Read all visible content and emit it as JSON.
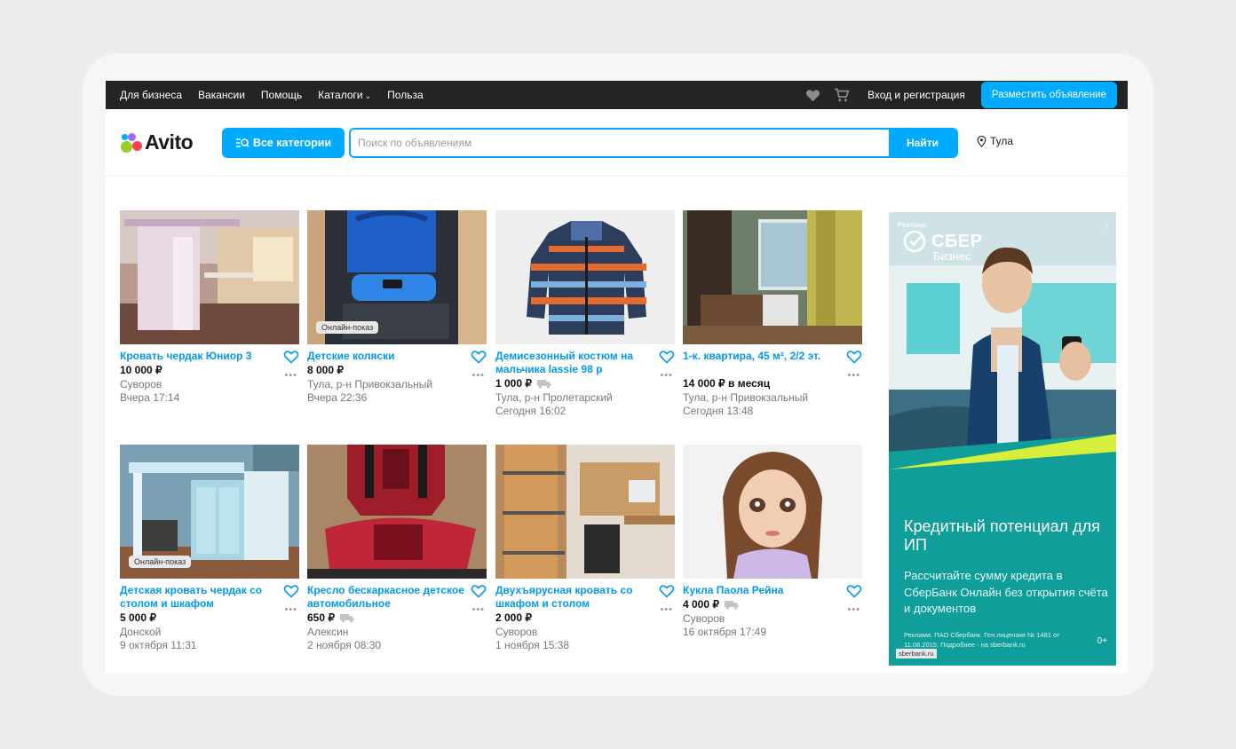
{
  "topbar": {
    "nav": [
      "Для бизнеса",
      "Вакансии",
      "Помощь",
      "Каталоги",
      "Польза"
    ],
    "login": "Вход и регистрация",
    "post_ad": "Разместить объявление"
  },
  "header": {
    "logo": "Avito",
    "categories_button": "Все категории",
    "search_placeholder": "Поиск по объявлениям",
    "search_button": "Найти",
    "city": "Тула"
  },
  "listings": [
    {
      "title": "Кровать чердак Юниор 3",
      "price": "10 000 ₽",
      "location": "Суворов",
      "date": "Вчера 17:14",
      "badge": "",
      "delivery": false
    },
    {
      "title": "Детские коляски",
      "price": "8 000 ₽",
      "location": "Тула, р-н Привокзальный",
      "date": "Вчера 22:36",
      "badge": "Онлайн-показ",
      "delivery": false
    },
    {
      "title": "Демисезонный костюм на мальчика lassie 98 р",
      "price": "1 000 ₽",
      "location": "Тула, р-н Пролетарский",
      "date": "Сегодня 16:02",
      "badge": "",
      "delivery": true
    },
    {
      "title": "1-к. квартира, 45 м², 2/2 эт.",
      "price": "14 000 ₽ в месяц",
      "location": "Тула, р-н Привокзальный",
      "date": "Сегодня 13:48",
      "badge": "",
      "delivery": false
    },
    {
      "title": "Детская кровать чердак со столом и шкафом",
      "price": "5 000 ₽",
      "location": "Донской",
      "date": "9 октября 11:31",
      "badge": "Онлайн-показ",
      "delivery": false
    },
    {
      "title": "Кресло бескаркасное детское автомобильное",
      "price": "650 ₽",
      "location": "Алексин",
      "date": "2 ноября 08:30",
      "badge": "",
      "delivery": true
    },
    {
      "title": "Двухъярусная кровать со шкафом и столом",
      "price": "2 000 ₽",
      "location": "Суворов",
      "date": "1 ноября 15:38",
      "badge": "",
      "delivery": false
    },
    {
      "title": "Кукла Паола Рейна",
      "price": "4 000 ₽",
      "location": "Суворов",
      "date": "16 октября 17:49",
      "badge": "",
      "delivery": true
    }
  ],
  "ad": {
    "label": "Реклама",
    "info": "i",
    "brand": "СБЕР",
    "brand_sub": "Бизнес",
    "headline": "Кредитный потенциал для ИП",
    "text": "Рассчитайте сумму кредита в СберБанк Онлайн без открытия счёта и документов",
    "legal": "Реклама. ПАО Сбербанк. Ген.лицензия № 1481 от 11.08.2015. Подробнее - на sberbank.ru",
    "age": "0+",
    "site": "sberbank.ru"
  },
  "colors": {
    "accent": "#00aaff",
    "link": "#0099ee",
    "topbar": "#242424",
    "ad_bg": "#0f9e9a"
  }
}
